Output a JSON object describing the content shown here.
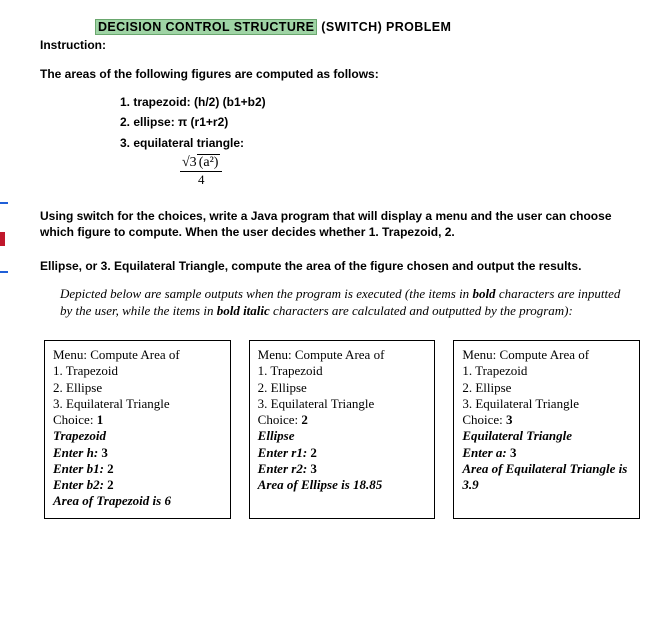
{
  "title": {
    "highlight": "DECISION CONTROL STRUCTURE",
    "plain": " (SWITCH) PROBLEM"
  },
  "instruction_label": "Instruction:",
  "intro": "The areas of the following figures are computed as follows:",
  "formulas": {
    "l1": "1.   trapezoid: (h/2) (b1+b2)",
    "l2": "2.   ellipse: π (r1+r2)",
    "l3": "3.   equilateral triangle:",
    "eq_num_root": "√3",
    "eq_num_paren": "(a²)",
    "eq_den": "4"
  },
  "body1": "Using switch for the choices, write a Java program that will display a menu and the user can choose which figure to compute. When the user decides whether 1. Trapezoid, 2.",
  "body2": "Ellipse, or 3. Equilateral Triangle, compute the area of the figure chosen and output the results.",
  "note": {
    "p1": "Depicted below are sample outputs when the program is executed (the items in ",
    "b1": "bold",
    "p2": " characters are inputted by the user, while the items in ",
    "b2": "bold italic",
    "p3": " characters are calculated and outputted by the program):"
  },
  "samples": [
    {
      "menu_head": "Menu: Compute Area of",
      "m1": "1. Trapezoid",
      "m2": "2. Ellipse",
      "m3": "3. Equilateral Triangle",
      "choice_label": "Choice: ",
      "choice_val": "1",
      "shape": "Trapezoid",
      "lines": [
        {
          "label": "Enter h: ",
          "val": "3"
        },
        {
          "label": "Enter b1: ",
          "val": "2"
        },
        {
          "label": "Enter b2: ",
          "val": "2"
        }
      ],
      "result": "Area of Trapezoid is 6"
    },
    {
      "menu_head": "Menu: Compute Area of",
      "m1": "1. Trapezoid",
      "m2": "2. Ellipse",
      "m3": "3. Equilateral Triangle",
      "choice_label": "Choice: ",
      "choice_val": "2",
      "shape": "Ellipse",
      "lines": [
        {
          "label": "Enter r1: ",
          "val": "2"
        },
        {
          "label": "Enter r2: ",
          "val": "3"
        }
      ],
      "result": "Area of Ellipse is 18.85"
    },
    {
      "menu_head": "Menu: Compute Area of",
      "m1": "1. Trapezoid",
      "m2": "2. Ellipse",
      "m3": "3. Equilateral Triangle",
      "choice_label": "Choice: ",
      "choice_val": "3",
      "shape": "Equilateral Triangle",
      "lines": [
        {
          "label": "Enter a: ",
          "val": "3"
        }
      ],
      "result": "Area of Equilateral Triangle is 3.9"
    }
  ]
}
